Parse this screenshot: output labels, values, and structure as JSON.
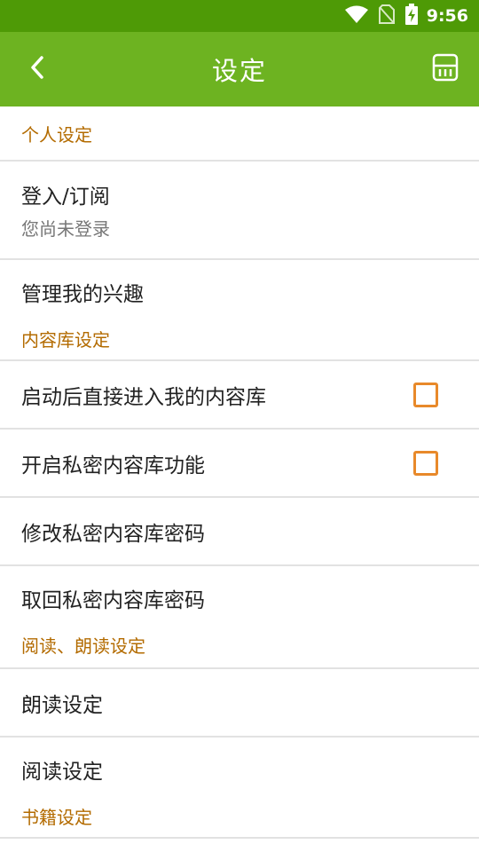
{
  "status_bar": {
    "time": "9:56",
    "icons": [
      "wifi-icon",
      "no-sim-icon",
      "battery-charging-icon"
    ]
  },
  "app_bar": {
    "title": "设定",
    "back_icon": "chevron-left-icon",
    "save_icon": "sd-card-icon"
  },
  "sections": {
    "personal": "个人设定",
    "library": "内容库设定",
    "reading": "阅读、朗读设定",
    "books": "书籍设定"
  },
  "items": {
    "login": {
      "label": "登入/订阅",
      "sub": "您尚未登录"
    },
    "interests": {
      "label": "管理我的兴趣"
    },
    "start_library": {
      "label": "启动后直接进入我的内容库",
      "checked": false
    },
    "private_library": {
      "label": "开启私密内容库功能",
      "checked": false
    },
    "change_password": {
      "label": "修改私密内容库密码"
    },
    "recover_password": {
      "label": "取回私密内容库密码"
    },
    "read_aloud": {
      "label": "朗读设定"
    },
    "reading": {
      "label": "阅读设定"
    }
  },
  "colors": {
    "status_bar": "#4e9a06",
    "app_bar": "#6db321",
    "section_header": "#b36b00",
    "checkbox": "#e8892a"
  }
}
